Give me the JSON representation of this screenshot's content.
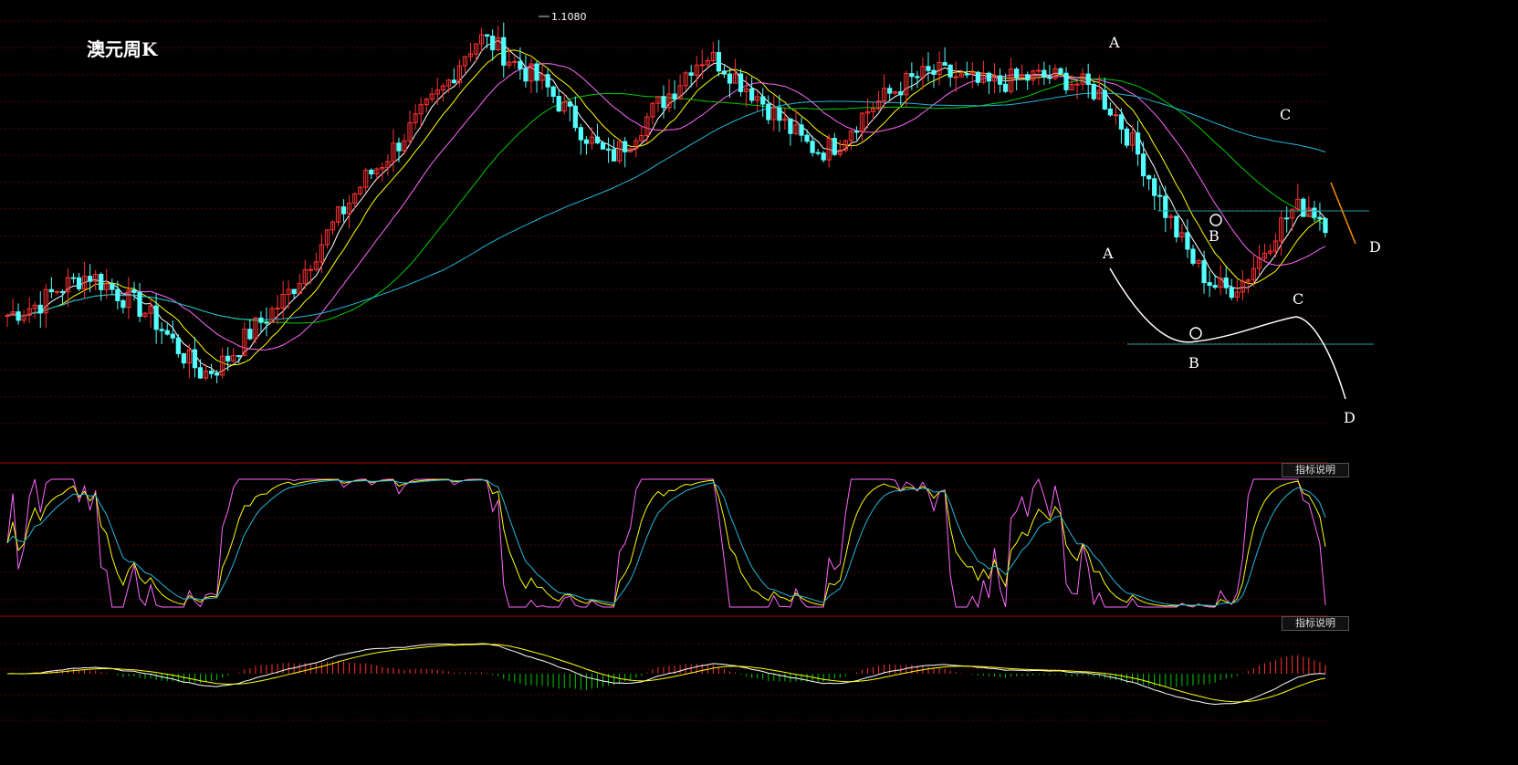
{
  "chart_title": "澳元周K",
  "max_price_label": "1.1080",
  "indicator_button_label": "指标说明",
  "annotations_top": {
    "a": "A",
    "b": "B",
    "c": "C",
    "d": "D"
  },
  "annotations_schematic": {
    "a": "A",
    "b": "B",
    "c": "C",
    "d": "D"
  },
  "colors": {
    "background": "#000000",
    "up_candle": "#ff3232",
    "down_candle": "#54ffff",
    "ma_white": "#ffffff",
    "ma_yellow": "#ffff00",
    "ma_magenta": "#ff66ff",
    "ma_green": "#00cc00",
    "ma_cyan": "#22b8dd",
    "support_line": "#1aa0a0",
    "projection": "#ff8c00",
    "grid": "#5a0000",
    "panel_border": "#b00000"
  },
  "chart_data": [
    {
      "type": "line",
      "title": "澳元周K",
      "series": [
        {
          "values": [
            0.962,
            0.965,
            0.968,
            0.975,
            0.979,
            0.983,
            0.978,
            0.972,
            0.967,
            0.96,
            0.95,
            0.94,
            0.932,
            0.936,
            0.944,
            0.954,
            0.962,
            0.97,
            0.982,
            0.995,
            1.008,
            1.02,
            1.032,
            1.04,
            1.05,
            1.06,
            1.07,
            1.08,
            1.095,
            1.104,
            1.1,
            1.092,
            1.086,
            1.08,
            1.07,
            1.06,
            1.05,
            1.042,
            1.05,
            1.06,
            1.07,
            1.078,
            1.09,
            1.095,
            1.09,
            1.082,
            1.075,
            1.066,
            1.058,
            1.05,
            1.046,
            1.05,
            1.06,
            1.068,
            1.074,
            1.08,
            1.084,
            1.086,
            1.085,
            1.082,
            1.08,
            1.081,
            1.083,
            1.084,
            1.084,
            1.083,
            1.08,
            1.076,
            1.066,
            1.052,
            1.036,
            1.018,
            1.002,
            0.988,
            0.978,
            0.975,
            0.98,
            0.992,
            1.006,
            1.016,
            1.018,
            1.01
          ]
        }
      ]
    }
  ]
}
